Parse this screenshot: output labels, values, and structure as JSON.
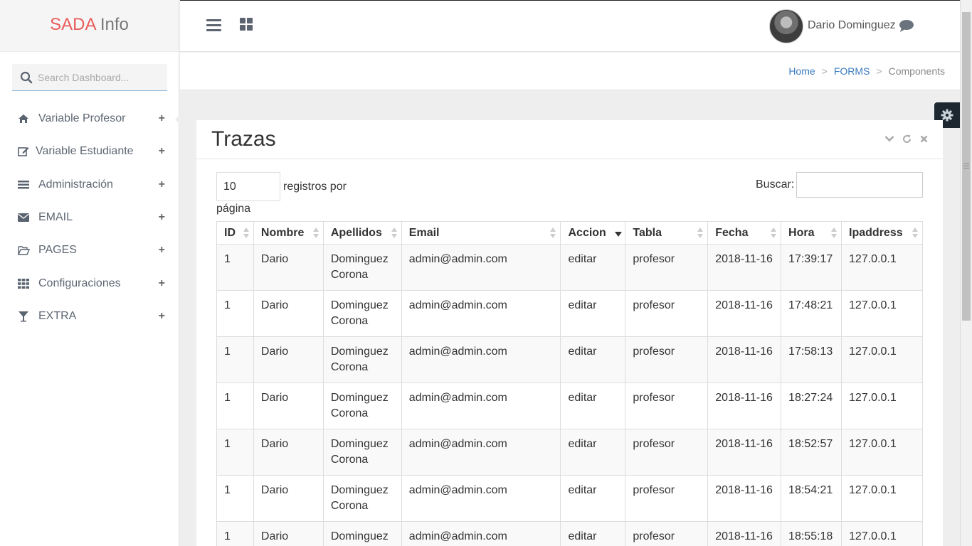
{
  "brand": {
    "part1": "SADA",
    "part2": "Info"
  },
  "sidebar": {
    "search_placeholder": "Search Dashboard...",
    "items": [
      {
        "label": "Variable Profesor",
        "icon": "home-icon"
      },
      {
        "label": "Variable Estudiante",
        "icon": "edit-icon"
      },
      {
        "label": "Administración",
        "icon": "list-icon"
      },
      {
        "label": "EMAIL",
        "icon": "envelope-icon"
      },
      {
        "label": "PAGES",
        "icon": "folder-open-icon"
      },
      {
        "label": "Configuraciones",
        "icon": "grid-icon"
      },
      {
        "label": "EXTRA",
        "icon": "cocktail-icon"
      }
    ],
    "expand_glyph": "+"
  },
  "topbar": {
    "user_name": "Dario Dominguez"
  },
  "breadcrumb": {
    "home": "Home",
    "sep": ">",
    "forms": "FORMS",
    "current": "Components"
  },
  "panel": {
    "title": "Trazas"
  },
  "table_controls": {
    "page_length": "10",
    "length_label_1": "registros por",
    "length_label_2": "página",
    "search_label": "Buscar:"
  },
  "table": {
    "headers": [
      "ID",
      "Nombre",
      "Apellidos",
      "Email",
      "Accion",
      "Tabla",
      "Fecha",
      "Hora",
      "Ipaddress"
    ],
    "rows": [
      [
        "1",
        "Dario",
        "Dominguez Corona",
        "admin@admin.com",
        "editar",
        "profesor",
        "2018-11-16",
        "17:39:17",
        "127.0.0.1"
      ],
      [
        "1",
        "Dario",
        "Dominguez Corona",
        "admin@admin.com",
        "editar",
        "profesor",
        "2018-11-16",
        "17:48:21",
        "127.0.0.1"
      ],
      [
        "1",
        "Dario",
        "Dominguez Corona",
        "admin@admin.com",
        "editar",
        "profesor",
        "2018-11-16",
        "17:58:13",
        "127.0.0.1"
      ],
      [
        "1",
        "Dario",
        "Dominguez Corona",
        "admin@admin.com",
        "editar",
        "profesor",
        "2018-11-16",
        "18:27:24",
        "127.0.0.1"
      ],
      [
        "1",
        "Dario",
        "Dominguez Corona",
        "admin@admin.com",
        "editar",
        "profesor",
        "2018-11-16",
        "18:52:57",
        "127.0.0.1"
      ],
      [
        "1",
        "Dario",
        "Dominguez Corona",
        "admin@admin.com",
        "editar",
        "profesor",
        "2018-11-16",
        "18:54:21",
        "127.0.0.1"
      ],
      [
        "1",
        "Dario",
        "Dominguez",
        "admin@admin.com",
        "editar",
        "profesor",
        "2018-11-16",
        "18:55:18",
        "127.0.0.1"
      ]
    ]
  },
  "colors": {
    "brand_red": "#e95b5b",
    "link_blue": "#3a7bbf",
    "settings_bg": "#1d2730"
  }
}
